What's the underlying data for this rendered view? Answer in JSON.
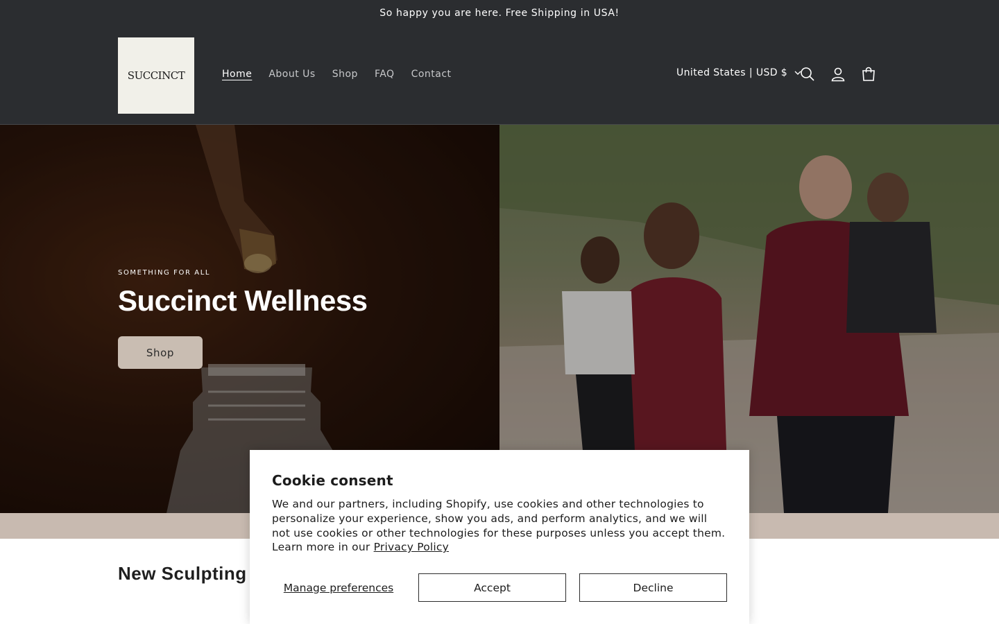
{
  "announcement": {
    "text": "So happy you are here. Free Shipping in USA!"
  },
  "header": {
    "logo_text": "SUCCINCT",
    "nav": [
      {
        "label": "Home",
        "active": true
      },
      {
        "label": "About Us",
        "active": false
      },
      {
        "label": "Shop",
        "active": false
      },
      {
        "label": "FAQ",
        "active": false
      },
      {
        "label": "Contact",
        "active": false
      }
    ],
    "locale_label": "United States | USD $",
    "icons": [
      "search-icon",
      "account-icon",
      "cart-icon"
    ]
  },
  "hero": {
    "eyebrow": "SOMETHING FOR ALL",
    "title": "Succinct Wellness",
    "button_label": "Shop"
  },
  "section": {
    "title": "New Sculpting T"
  },
  "cookie": {
    "title": "Cookie consent",
    "body": "We and our partners, including Shopify, use cookies and other technologies to personalize your experience, show you ads, and perform analytics, and we will not use cookies or other technologies for these purposes unless you accept them. Learn more in our ",
    "privacy_link": "Privacy Policy",
    "manage_label": "Manage preferences",
    "accept_label": "Accept",
    "decline_label": "Decline"
  },
  "colors": {
    "header_bg": "#2b2d30",
    "hero_button_bg": "#c9bdb2",
    "band_bg": "#c8bab0"
  }
}
